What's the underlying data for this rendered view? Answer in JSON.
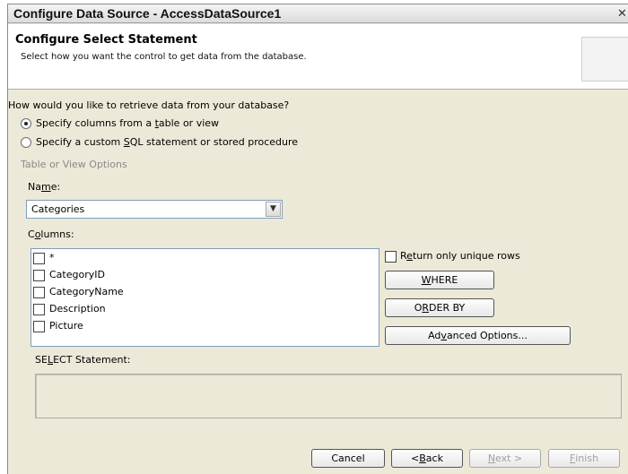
{
  "window": {
    "title": "Configure Data Source - AccessDataSource1",
    "close_glyph": "✕"
  },
  "header": {
    "title": "Configure Select Statement",
    "subtitle": "Select how you want the control to get data from the database."
  },
  "question": "How would you like to retrieve data from your database?",
  "radios": [
    {
      "label": "Specify columns from a table or view",
      "checked": true
    },
    {
      "label": "Specify a custom SQL statement or stored procedure",
      "checked": false
    }
  ],
  "table_options": {
    "group_label": "Table or View Options",
    "name_label": "Name:",
    "name_value": "Categories",
    "columns_label": "Columns:",
    "columns": [
      "*",
      "CategoryID",
      "CategoryName",
      "Description",
      "Picture"
    ]
  },
  "unique_rows_label": "Return only unique rows",
  "buttons": {
    "where": "WHERE",
    "order_by": "ORDER BY",
    "advanced": "Advanced Options..."
  },
  "select_statement_label": "SELECT Statement:",
  "select_statement_value": "",
  "footer": {
    "cancel": "Cancel",
    "back": "< Back",
    "next": "Next >",
    "finish": "Finish"
  },
  "icons": {
    "dropdown": "chevron-down-icon",
    "close": "close-icon"
  }
}
